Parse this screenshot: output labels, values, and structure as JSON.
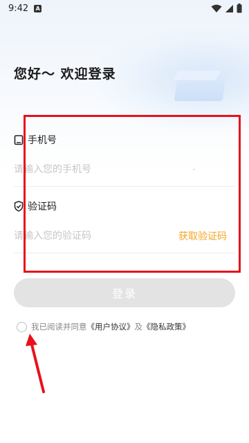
{
  "status_bar": {
    "time": "9:42",
    "notification_glyph": "A",
    "icons": [
      "wifi-icon",
      "signal-icon",
      "battery-icon"
    ]
  },
  "header": {
    "greeting": "您好～ 欢迎登录"
  },
  "form": {
    "phone": {
      "label": "手机号",
      "icon": "phone-icon",
      "placeholder": "请输入您的手机号",
      "value": ""
    },
    "code": {
      "label": "验证码",
      "icon": "shield-check-icon",
      "placeholder": "请输入您的验证码",
      "value": "",
      "get_code_label": "获取验证码"
    }
  },
  "login_button": {
    "label": "登录"
  },
  "agreement": {
    "prefix": "我已阅读并同意",
    "user_agreement": "《用户协议》",
    "conjunction": "及",
    "privacy_policy": "《隐私政策》",
    "checked": false
  },
  "colors": {
    "accent": "#f5a623",
    "highlight": "#e8111b",
    "button_disabled": "#e3e3e3"
  }
}
